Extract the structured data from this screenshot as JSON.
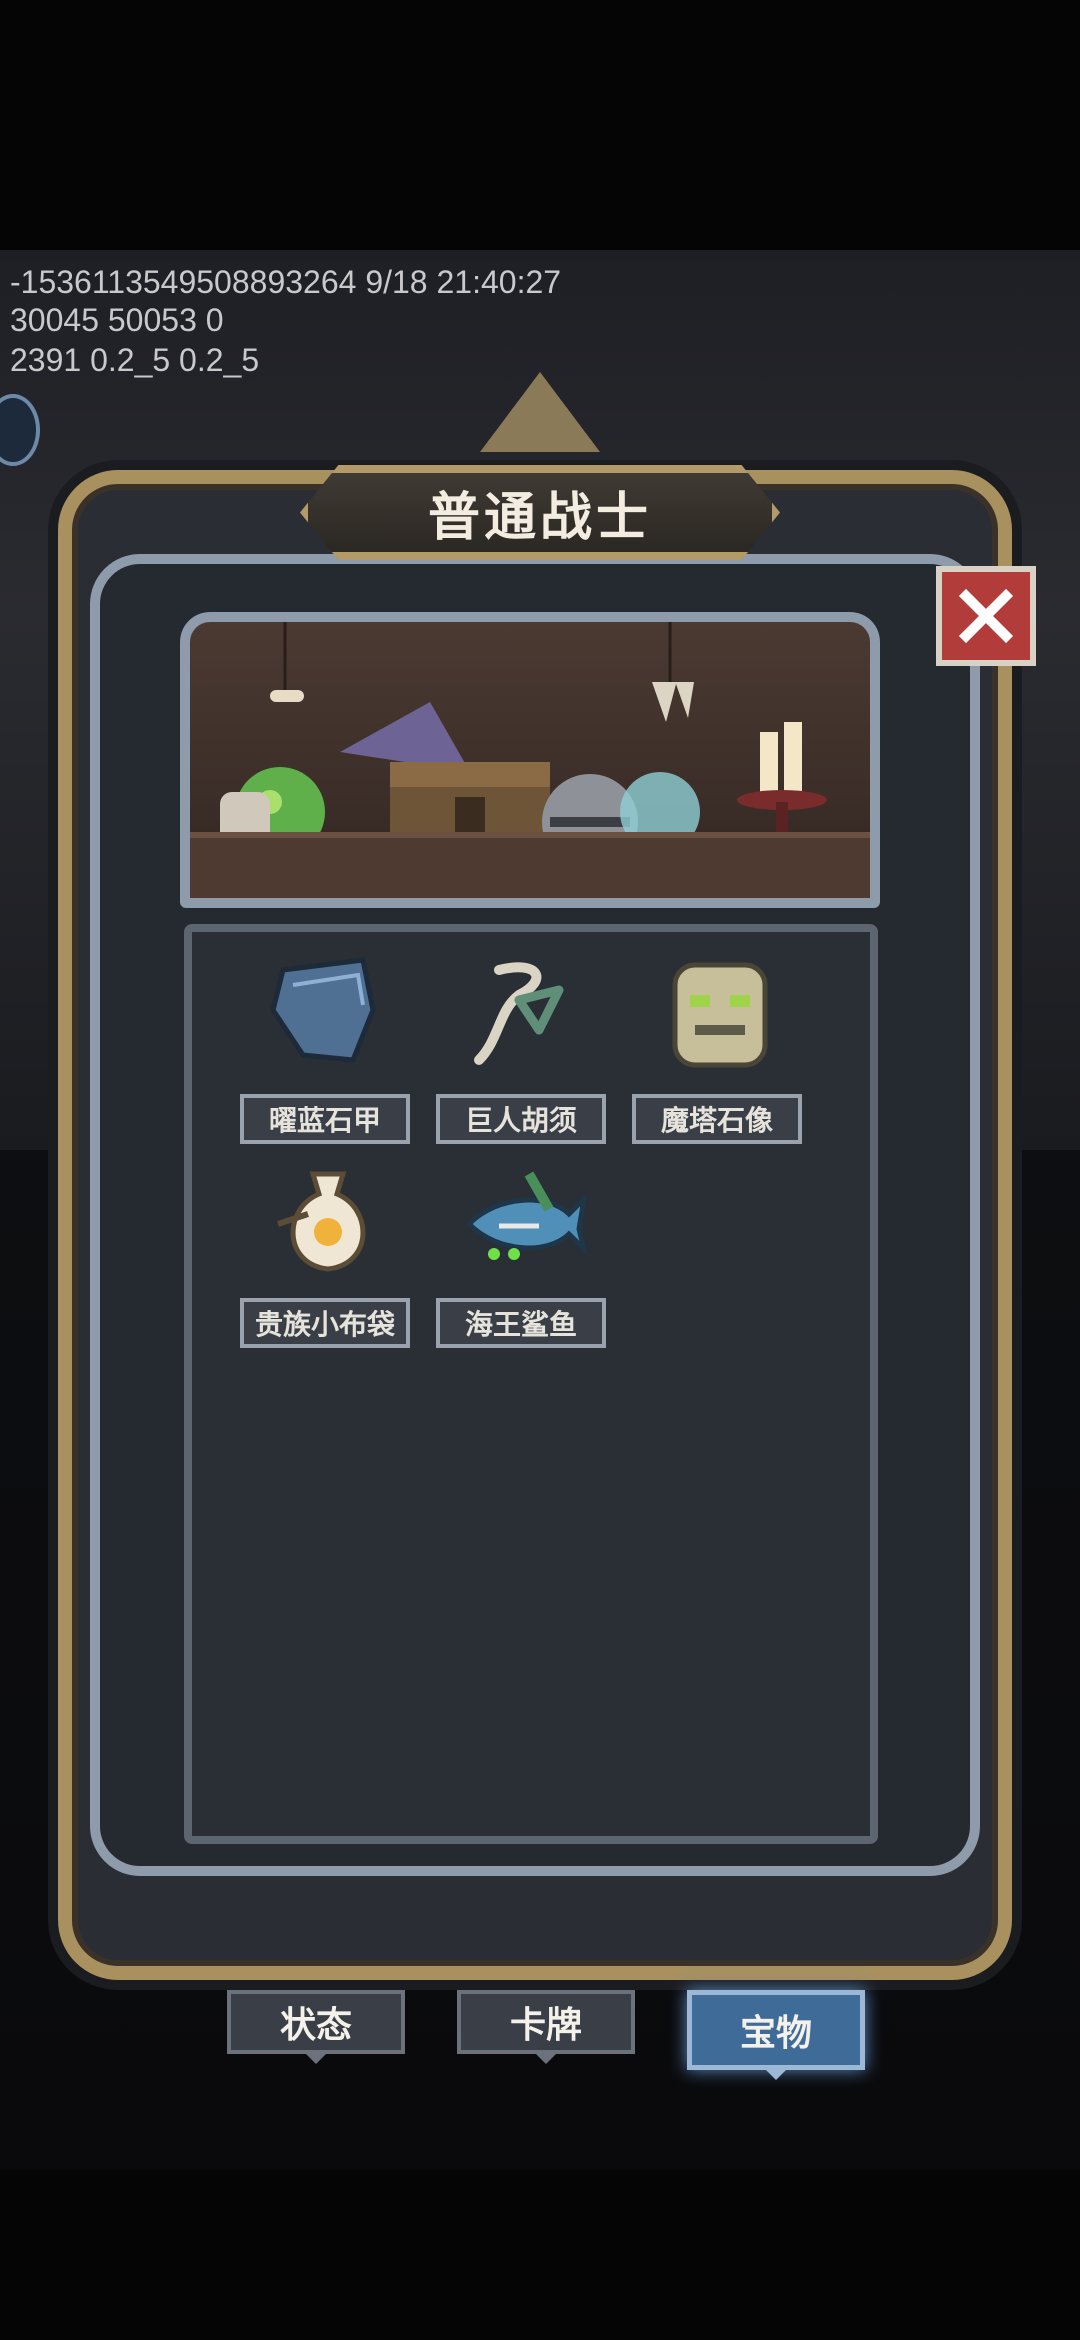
{
  "debug": {
    "line1": "-1536113549508893264 9/18 21:40:27",
    "line2": "30045 50053 0",
    "line3": "2391 0.2_5 0.2_5"
  },
  "dialog": {
    "title": "普通战士",
    "close_icon": "close-icon"
  },
  "treasures": [
    {
      "label": "曜蓝石甲",
      "icon": "blue-armor-icon"
    },
    {
      "label": "巨人胡须",
      "icon": "giant-beard-icon"
    },
    {
      "label": "魔塔石像",
      "icon": "stone-totem-icon"
    },
    {
      "label": "贵族小布袋",
      "icon": "cloth-bag-icon"
    },
    {
      "label": "海王鲨鱼",
      "icon": "shark-icon"
    }
  ],
  "tabs": [
    {
      "label": "状态",
      "active": false
    },
    {
      "label": "卡牌",
      "active": false
    },
    {
      "label": "宝物",
      "active": true
    }
  ],
  "colors": {
    "frame_gold": "#a8905f",
    "close_red": "#b23c3a",
    "tab_active": "#3f6b98"
  }
}
